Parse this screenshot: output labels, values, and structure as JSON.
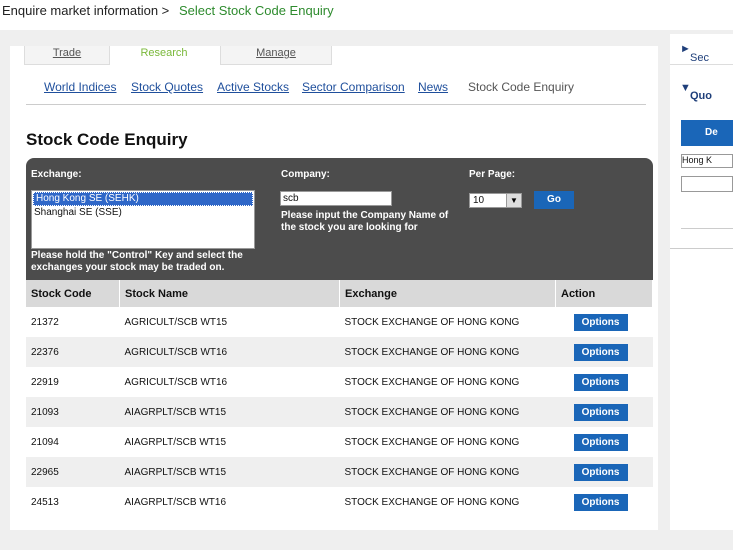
{
  "breadcrumb": {
    "parent": "Enquire market information >",
    "current": "Select Stock Code Enquiry"
  },
  "tabs": [
    "Trade",
    "Research",
    "Manage"
  ],
  "subnav": [
    "World Indices",
    "Stock Quotes",
    "Active Stocks",
    "Sector Comparison",
    "News",
    "Stock Code Enquiry"
  ],
  "page_title": "Stock Code Enquiry",
  "filter": {
    "exchange_label": "Exchange:",
    "exchange_options": [
      "Hong Kong SE (SEHK)",
      "Shanghai SE (SSE)"
    ],
    "exchange_hint_1": "Please hold the \"Control\" Key and select the",
    "exchange_hint_2": "exchanges your stock may be traded on.",
    "company_label": "Company:",
    "company_value": "scb",
    "company_hint_1": "Please input the Company Name of",
    "company_hint_2": "the stock you are looking for",
    "perpage_label": "Per Page:",
    "perpage_value": "10",
    "go_label": "Go"
  },
  "table": {
    "headers": [
      "Stock Code",
      "Stock Name",
      "Exchange",
      "Action"
    ],
    "action_label": "Options",
    "rows": [
      [
        "21372",
        "AGRICULT/SCB WT15",
        "STOCK EXCHANGE OF HONG KONG"
      ],
      [
        "22376",
        "AGRICULT/SCB WT16",
        "STOCK EXCHANGE OF HONG KONG"
      ],
      [
        "22919",
        "AGRICULT/SCB WT16",
        "STOCK EXCHANGE OF HONG KONG"
      ],
      [
        "21093",
        "AIAGRPLT/SCB WT15",
        "STOCK EXCHANGE OF HONG KONG"
      ],
      [
        "21094",
        "AIAGRPLT/SCB WT15",
        "STOCK EXCHANGE OF HONG KONG"
      ],
      [
        "22965",
        "AIAGRPLT/SCB WT15",
        "STOCK EXCHANGE OF HONG KONG"
      ],
      [
        "24513",
        "AIAGRPLT/SCB WT16",
        "STOCK EXCHANGE OF HONG KONG"
      ]
    ]
  },
  "sidebar": {
    "section1": "Sec",
    "section2": "Quo",
    "button": "De",
    "select_value": "Hong K"
  }
}
